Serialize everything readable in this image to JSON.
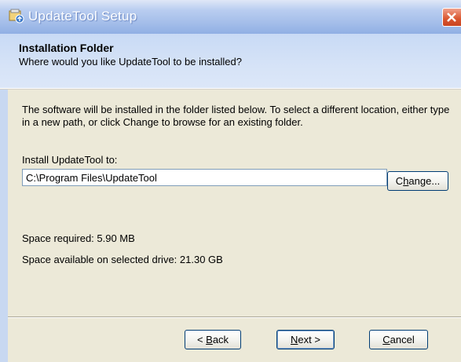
{
  "window": {
    "title": "UpdateTool Setup"
  },
  "header": {
    "title": "Installation Folder",
    "subtitle": "Where would you like UpdateTool to be installed?"
  },
  "main": {
    "description": "The software will be installed in the folder listed below. To select a different location, either type in a new path, or click Change to browse for an existing folder.",
    "install_label": "Install UpdateTool to:",
    "install_path": "C:\\Program Files\\UpdateTool",
    "change_button": {
      "before": "C",
      "underlined": "h",
      "after": "ange..."
    },
    "space_required": "Space required: 5.90 MB",
    "space_available": "Space available on selected drive: 21.30 GB"
  },
  "footer": {
    "back_button": {
      "before": "< ",
      "underlined": "B",
      "after": "ack"
    },
    "next_button": {
      "before": "",
      "underlined": "N",
      "after": "ext >"
    },
    "cancel_button": {
      "before": "",
      "underlined": "C",
      "after": "ancel"
    }
  },
  "icons": {
    "app_icon": "installer-icon",
    "close_icon": "close-icon"
  }
}
